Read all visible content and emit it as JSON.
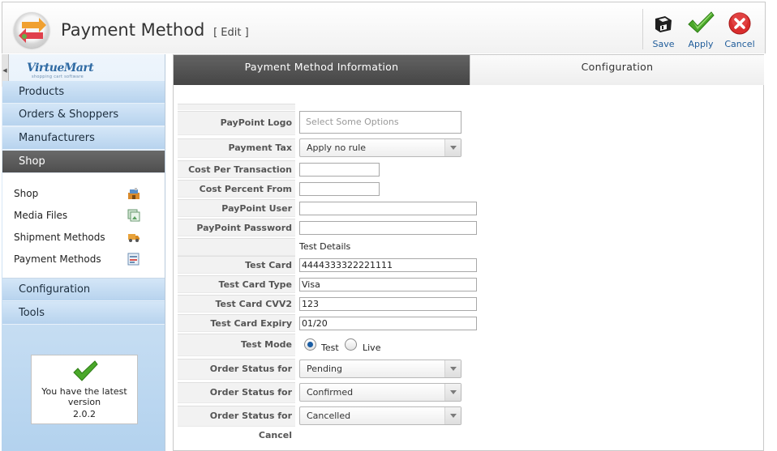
{
  "header": {
    "title": "Payment Method",
    "subtitle": "[ Edit ]",
    "toolbar": {
      "save_label": "Save",
      "apply_label": "Apply",
      "cancel_label": "Cancel"
    }
  },
  "sidebar": {
    "logo_text": "VirtueMart",
    "logo_tagline": "shopping cart software",
    "nav": {
      "products": "Products",
      "orders": "Orders & Shoppers",
      "manufacturers": "Manufacturers",
      "shop": "Shop",
      "configuration": "Configuration",
      "tools": "Tools"
    },
    "shop_submenu": {
      "shop": "Shop",
      "media": "Media Files",
      "shipment": "Shipment Methods",
      "payment": "Payment Methods"
    },
    "version": {
      "message": "You have the latest version",
      "number": "2.0.2"
    }
  },
  "tabs": {
    "info": "Payment Method Information",
    "config": "Configuration"
  },
  "form": {
    "logo": {
      "label": "PayPoint Logo",
      "placeholder": "Select Some Options"
    },
    "tax": {
      "label": "Payment Tax",
      "value": "Apply no rule"
    },
    "cost_per_transaction": {
      "label": "Cost Per Transaction",
      "value": ""
    },
    "cost_percent": {
      "label": "Cost Percent From Total",
      "value": ""
    },
    "user": {
      "label": "PayPoint User",
      "value": ""
    },
    "password": {
      "label": "PayPoint Password",
      "value": ""
    },
    "test_details": "Test Details",
    "test_card": {
      "label": "Test Card",
      "value": "4444333322221111"
    },
    "test_card_type": {
      "label": "Test Card Type",
      "value": "Visa"
    },
    "test_card_cvv2": {
      "label": "Test Card CVV2",
      "value": "123"
    },
    "test_card_expiry": {
      "label": "Test Card Expiry",
      "value": "01/20"
    },
    "test_mode": {
      "label": "Test Mode",
      "option_test": "Test",
      "option_live": "Live",
      "selected": "Test"
    },
    "status_pending": {
      "label": "Order Status for Pending",
      "value": "Pending"
    },
    "status_success": {
      "label": "Order Status for Success",
      "value": "Confirmed"
    },
    "status_cancel": {
      "label": "Order Status for Cancel",
      "value": "Cancelled"
    }
  }
}
